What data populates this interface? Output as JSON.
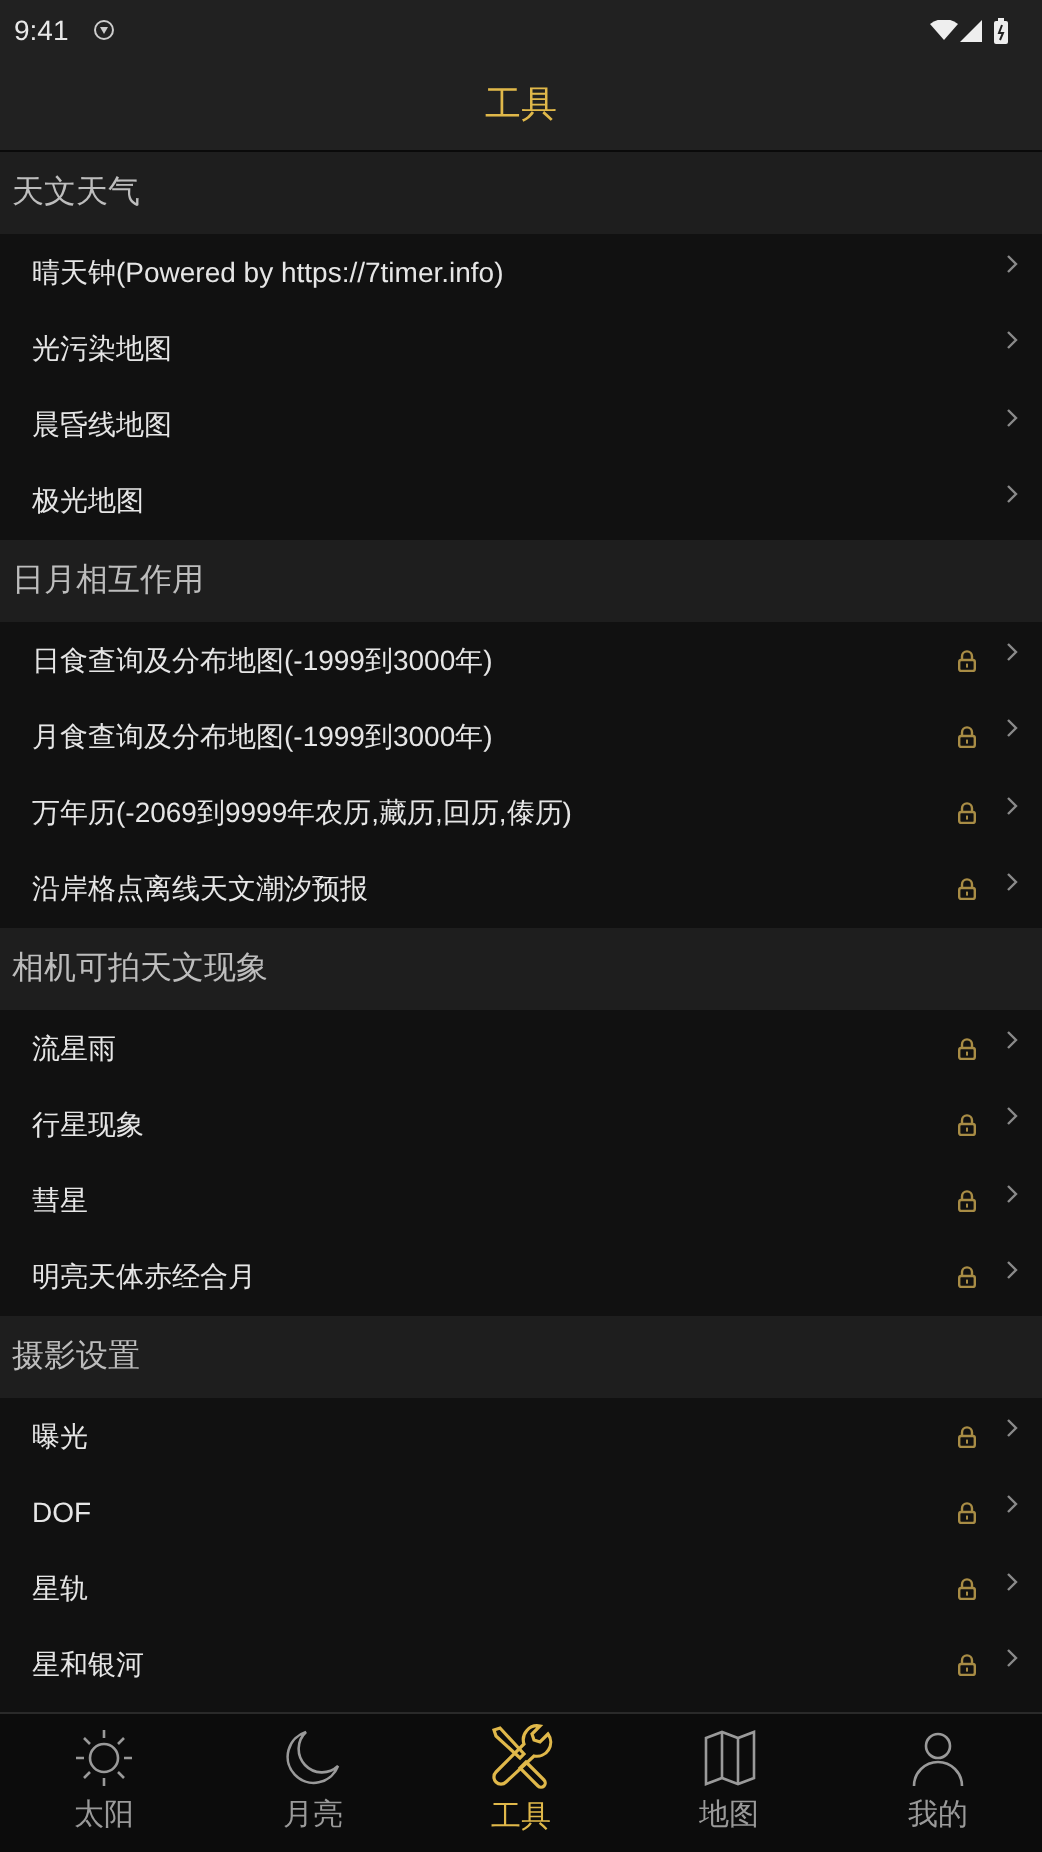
{
  "status_bar": {
    "time": "9:41"
  },
  "header": {
    "title": "工具"
  },
  "sections": [
    {
      "title": "天文天气",
      "items": [
        {
          "label": "晴天钟(Powered by https://7timer.info)",
          "locked": false
        },
        {
          "label": "光污染地图",
          "locked": false
        },
        {
          "label": "晨昏线地图",
          "locked": false
        },
        {
          "label": "极光地图",
          "locked": false
        }
      ]
    },
    {
      "title": "日月相互作用",
      "items": [
        {
          "label": "日食查询及分布地图(-1999到3000年)",
          "locked": true
        },
        {
          "label": "月食查询及分布地图(-1999到3000年)",
          "locked": true
        },
        {
          "label": "万年历(-2069到9999年农历,藏历,回历,傣历)",
          "locked": true
        },
        {
          "label": "沿岸格点离线天文潮汐预报",
          "locked": true
        }
      ]
    },
    {
      "title": "相机可拍天文现象",
      "items": [
        {
          "label": "流星雨",
          "locked": true
        },
        {
          "label": "行星现象",
          "locked": true
        },
        {
          "label": "彗星",
          "locked": true
        },
        {
          "label": "明亮天体赤经合月",
          "locked": true
        }
      ]
    },
    {
      "title": "摄影设置",
      "items": [
        {
          "label": "曝光",
          "locked": true
        },
        {
          "label": "DOF",
          "locked": true
        },
        {
          "label": "星轨",
          "locked": true
        },
        {
          "label": "星和银河",
          "locked": true
        }
      ]
    }
  ],
  "tab_bar": [
    {
      "kind": "sun",
      "label": "太阳",
      "selected": false
    },
    {
      "kind": "moon",
      "label": "月亮",
      "selected": false
    },
    {
      "kind": "tools",
      "label": "工具",
      "selected": true
    },
    {
      "kind": "map",
      "label": "地图",
      "selected": false
    },
    {
      "kind": "person",
      "label": "我的",
      "selected": false
    }
  ]
}
